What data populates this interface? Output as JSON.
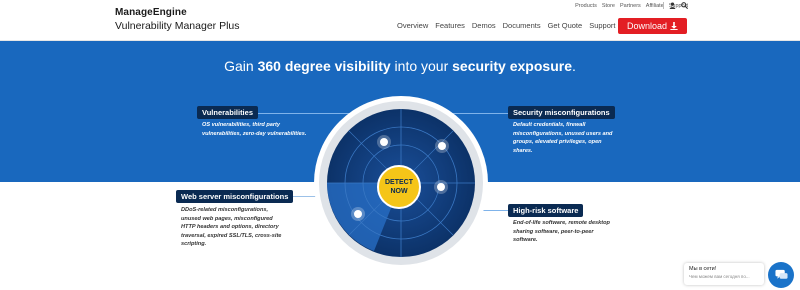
{
  "header": {
    "brand": "ManageEngine",
    "product": "Vulnerability Manager Plus",
    "util_links": [
      "Products",
      "Store",
      "Partners",
      "Affiliate",
      "Support"
    ],
    "nav": [
      "Overview",
      "Features",
      "Demos",
      "Documents",
      "Get Quote",
      "Support"
    ],
    "download_label": "Download"
  },
  "hero": {
    "headline_pre": "Gain ",
    "headline_bold1": "360 degree visibility",
    "headline_mid": " into your ",
    "headline_bold2": "security exposure",
    "headline_post": ".",
    "center_button": {
      "line1": "DETECT",
      "line2": "NOW"
    }
  },
  "callouts": {
    "vulnerabilities": {
      "title": "Vulnerabilities",
      "lines": [
        "OS vulnerabilities, third party",
        "vulnerabilities, zero-day vulnerabilities."
      ]
    },
    "security_misconfig": {
      "title": "Security misconfigurations",
      "lines": [
        "Default credentials, firewall",
        "misconfigurations, unused users and",
        "groups, elevated privileges, open",
        "shares."
      ]
    },
    "web_server": {
      "title": "Web server misconfigurations",
      "lines": [
        "DDoS-related misconfigurations,",
        "unused web pages, misconfigured",
        "HTTP headers and options, directory",
        "traversal, expired SSL/TLS, cross-site",
        "scripting."
      ]
    },
    "high_risk": {
      "title": "High-risk software",
      "lines": [
        "End-of-life software, remote desktop",
        "sharing software, peer-to-peer",
        "software."
      ]
    }
  },
  "chat": {
    "title": "Мы в сети!",
    "subtitle": "Чем можем вам сегодня по..."
  },
  "colors": {
    "hero_bg": "#1968be",
    "tag_bg": "#0a2a52",
    "download_bg": "#e31e24",
    "detect_bg": "#f5c518",
    "radar_dark": "#0d3a75"
  }
}
